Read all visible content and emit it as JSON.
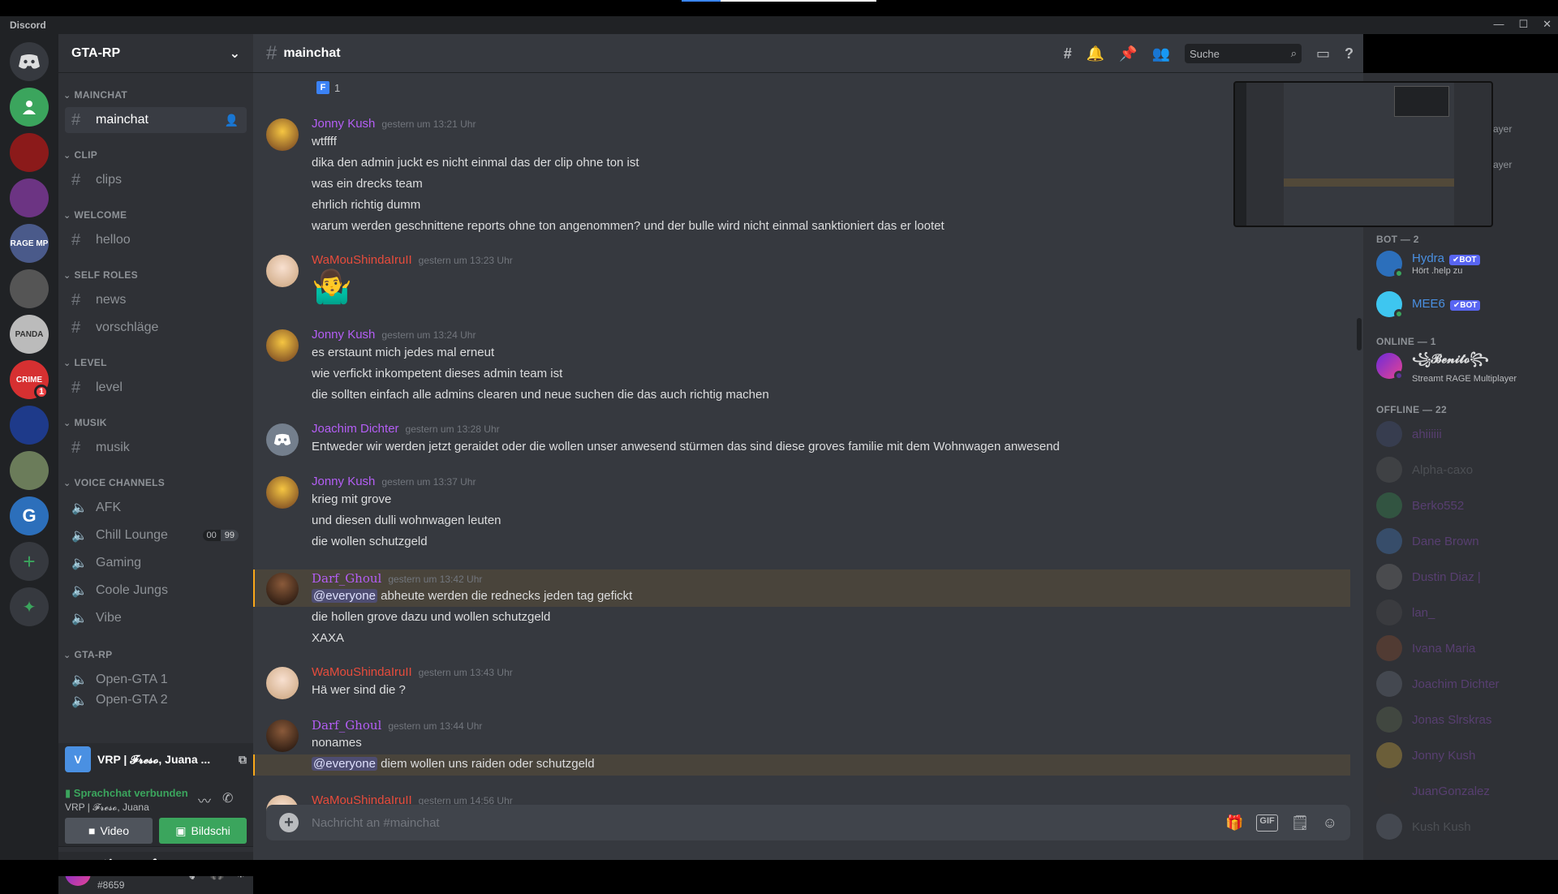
{
  "app": {
    "title": "Discord"
  },
  "servers": [
    {
      "name": "home",
      "color": "#36393f"
    },
    {
      "name": "friends-server",
      "color": "#3ba55d"
    },
    {
      "name": "server-2",
      "color": "#c0392b"
    },
    {
      "name": "server-3",
      "color": "#8e44ad"
    },
    {
      "name": "server-4",
      "color": "#4a5a8a",
      "label": "RAGE MP"
    },
    {
      "name": "server-5",
      "color": "#555"
    },
    {
      "name": "server-6",
      "color": "#ccc",
      "label": "PANDA SHOTS"
    },
    {
      "name": "server-7",
      "color": "#d63031",
      "label": "CRIME",
      "badge": "1"
    },
    {
      "name": "server-8",
      "color": "#1e3a8a"
    },
    {
      "name": "server-9",
      "color": "#6b7c5a"
    },
    {
      "name": "server-10",
      "color": "#2c6fbb",
      "label": "G"
    }
  ],
  "guild": {
    "name": "GTA-RP"
  },
  "categories": {
    "mainchat": "MAINCHAT",
    "clip": "CLIP",
    "welcome": "WELCOME",
    "self_roles": "SELF ROLES",
    "level": "LEVEL",
    "musik": "MUSIK",
    "voice": "VOICE CHANNELS",
    "gtarp": "GTA-RP"
  },
  "channels": {
    "mainchat": "mainchat",
    "clips": "clips",
    "helloo": "helloo",
    "news": "news",
    "vorschlaege": "vorschläge",
    "level": "level",
    "musik": "musik",
    "afk": "AFK",
    "chill": "Chill Lounge",
    "chill_count_a": "00",
    "chill_count_b": "99",
    "gaming": "Gaming",
    "coole": "Coole Jungs",
    "vibe": "Vibe",
    "open1": "Open-GTA 1",
    "open2": "Open-GTA 2"
  },
  "voice_panel": {
    "stream_title": "VRP | 𝓕𝓻𝓮𝓼𝓸, Juana ...",
    "status": "Sprachchat verbunden",
    "sub": "VRP | 𝓕𝓻𝓮𝓼𝓸, Juana",
    "video_label": "Video",
    "screen_label": "Bildschi"
  },
  "user": {
    "name": "꧁𝓑𝓮𝓷𝓲𝓽𝓸꧂",
    "tag": "#8659"
  },
  "header": {
    "channel": "mainchat",
    "search_placeholder": "Suche"
  },
  "reaction": {
    "emoji": "F",
    "count": "1"
  },
  "messages": [
    {
      "author": "Jonny Kush",
      "color": "#b45ef5",
      "time": "gestern um 13:21 Uhr",
      "lines": [
        "wtffff",
        "dika den admin juckt es nicht einmal das der clip ohne ton ist",
        "was ein drecks team",
        "ehrlich richtig dumm",
        "warum werden geschnittene reports ohne ton angenommen? und der bulle wird nicht einmal sanktioniert das er lootet"
      ]
    },
    {
      "author": "WaMouShindaIruII",
      "color": "#e74c3c",
      "time": "gestern um 13:23 Uhr",
      "lines": [
        "🤷‍♂️"
      ]
    },
    {
      "author": "Jonny Kush",
      "color": "#b45ef5",
      "time": "gestern um 13:24 Uhr",
      "lines": [
        "es erstaunt mich jedes mal erneut",
        "wie verfickt inkompetent dieses admin team ist",
        "die sollten einfach alle admins clearen und neue suchen die das auch richtig machen"
      ]
    },
    {
      "author": "Joachim Dichter",
      "color": "#b45ef5",
      "time": "gestern um 13:28 Uhr",
      "lines": [
        "Entweder wir werden jetzt geraidet oder die wollen unser anwesend stürmen das sind diese groves familie mit dem Wohnwagen anwesend"
      ]
    },
    {
      "author": "Jonny Kush",
      "color": "#b45ef5",
      "time": "gestern um 13:37 Uhr",
      "lines": [
        "krieg mit grove",
        "und diesen dulli wohnwagen leuten",
        "die wollen schutzgeld"
      ]
    },
    {
      "author": "Darf_Ghoul",
      "color": "#b45ef5",
      "time": "gestern um 13:42 Uhr",
      "mention": "@everyone",
      "first_line": "abheute werden die rednecks jeden tag gefickt",
      "lines": [
        "die hollen grove dazu und wollen schutzgeld",
        "XAXA"
      ]
    },
    {
      "author": "WaMouShindaIruII",
      "color": "#e74c3c",
      "time": "gestern um 13:43 Uhr",
      "lines": [
        "Hä wer sind die ?"
      ]
    },
    {
      "author": "Darf_Ghoul",
      "color": "#b45ef5",
      "time": "gestern um 13:44 Uhr",
      "lines": [
        "nonames"
      ],
      "mention": "@everyone",
      "mention_line": "diem wollen uns raiden oder schutzgeld"
    },
    {
      "author": "WaMouShindaIruII",
      "color": "#e74c3c",
      "time": "gestern um 14:56 Uhr",
      "lines": []
    }
  ],
  "composer": {
    "placeholder": "Nachricht an #mainchat"
  },
  "members": {
    "preview_rows": [
      "ayer",
      "ayer"
    ],
    "bot_header": "BOT — 2",
    "bots": [
      {
        "name": "Hydra",
        "badge": "✔BOT",
        "sub": "Hört .help zu",
        "color": "#4a90e2"
      },
      {
        "name": "MEE6",
        "badge": "✔BOT",
        "sub": "",
        "color": "#4a90e2"
      }
    ],
    "online_header": "ONLINE — 1",
    "online": [
      {
        "name": "꧁𝓑𝓮𝓷𝓲𝓽𝓸꧂",
        "sub": "Streamt RAGE Multiplayer"
      }
    ],
    "offline_header": "OFFLINE — 22",
    "offline": [
      "ahiiiiii",
      "Alpha-caxo",
      "Berko552",
      "Dane Brown",
      "Dustin Diaz |",
      "lan_",
      "Ivana Maria",
      "Joachim Dichter",
      "Jonas Slrskras",
      "Jonny Kush",
      "JuanGonzalez",
      "Kush Kush"
    ]
  }
}
